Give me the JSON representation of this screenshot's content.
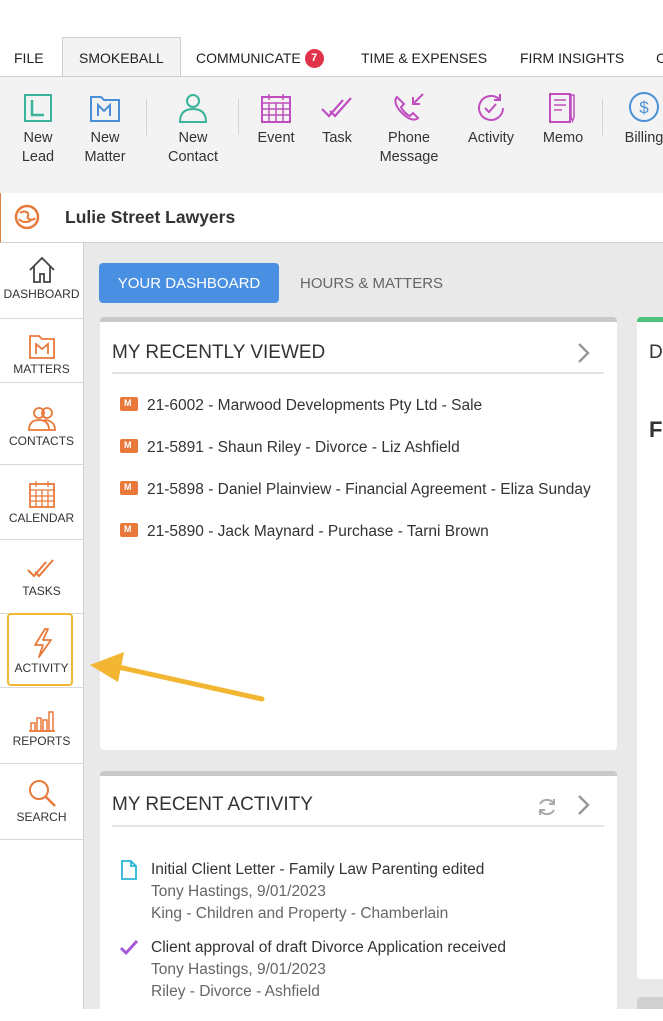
{
  "tabs": [
    {
      "label": "FILE"
    },
    {
      "label": "SMOKEBALL"
    },
    {
      "label": "COMMUNICATE",
      "badge": "7"
    },
    {
      "label": "TIME & EXPENSES"
    },
    {
      "label": "FIRM INSIGHTS"
    },
    {
      "label": "C"
    }
  ],
  "ribbon": {
    "new_lead": "New\nLead",
    "new_matter": "New\nMatter",
    "new_contact": "New\nContact",
    "event": "Event",
    "task": "Task",
    "phone_message": "Phone\nMessage",
    "activity": "Activity",
    "memo": "Memo",
    "billing": "Billing"
  },
  "firm": {
    "name": "Lulie Street Lawyers"
  },
  "sidebar": {
    "dashboard": "DASHBOARD",
    "matters": "MATTERS",
    "contacts": "CONTACTS",
    "calendar": "CALENDAR",
    "tasks": "TASKS",
    "activity": "ACTIVITY",
    "reports": "REPORTS",
    "search": "SEARCH"
  },
  "dashboard_tabs": {
    "active": "YOUR DASHBOARD",
    "other": "HOURS & MATTERS"
  },
  "recently_viewed": {
    "title": "MY RECENTLY VIEWED",
    "items": [
      "21-6002 - Marwood Developments Pty Ltd - Sale",
      "21-5891 - Shaun Riley - Divorce - Liz Ashfield",
      "21-5898 - Daniel Plainview - Financial Agreement - Eliza Sunday",
      "21-5890 - Jack Maynard - Purchase - Tarni Brown"
    ]
  },
  "recent_activity": {
    "title": "MY RECENT ACTIVITY",
    "items": [
      {
        "title": "Initial Client Letter - Family Law Parenting edited",
        "by": "Tony Hastings, 9/01/2023",
        "matter": "King - Children and Property - Chamberlain"
      },
      {
        "title": "Client approval of draft Divorce Application received",
        "by": "Tony Hastings, 9/01/2023",
        "matter": "Riley - Divorce - Ashfield"
      }
    ]
  },
  "right_card": {
    "title": "D",
    "text": "Fr"
  },
  "colors": {
    "accent": "#4a90e2",
    "brand_orange": "#e8793a",
    "highlight": "#f2b632",
    "badge": "#e0334a"
  }
}
